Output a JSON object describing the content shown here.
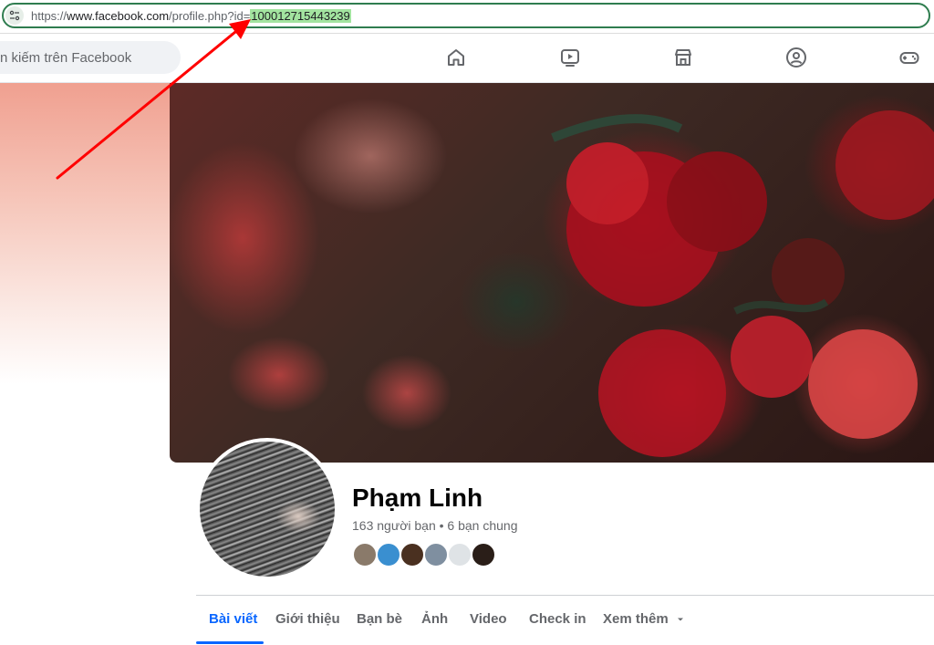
{
  "browser": {
    "url_prefix": "https://",
    "url_domain": "www.facebook.com",
    "url_path": "/profile.php?id=",
    "url_highlight": "100012715443239",
    "site_info_icon": "tune-icon"
  },
  "fb_header": {
    "search_placeholder": "n kiếm trên Facebook",
    "nav_icons": [
      "home-icon",
      "video-icon",
      "marketplace-icon",
      "groups-icon",
      "gaming-icon"
    ]
  },
  "profile": {
    "name": "Phạm Linh",
    "friends_summary": "163 người bạn • 6 bạn chung",
    "mutual_friend_colors": [
      "#8a7a6a",
      "#3a8fd0",
      "#4a3020",
      "#7f8fa0",
      "#dfe3e6",
      "#2a1e18"
    ]
  },
  "tabs": {
    "items": [
      "Bài viết",
      "Giới thiệu",
      "Bạn bè",
      "Ảnh",
      "Video",
      "Check in",
      "Xem thêm"
    ],
    "active_index": 0,
    "more_icon": "caret-down-icon"
  },
  "colors": {
    "annotation_arrow": "#ff0000",
    "highlight": "#a3e4a0",
    "accent": "#0866ff"
  }
}
